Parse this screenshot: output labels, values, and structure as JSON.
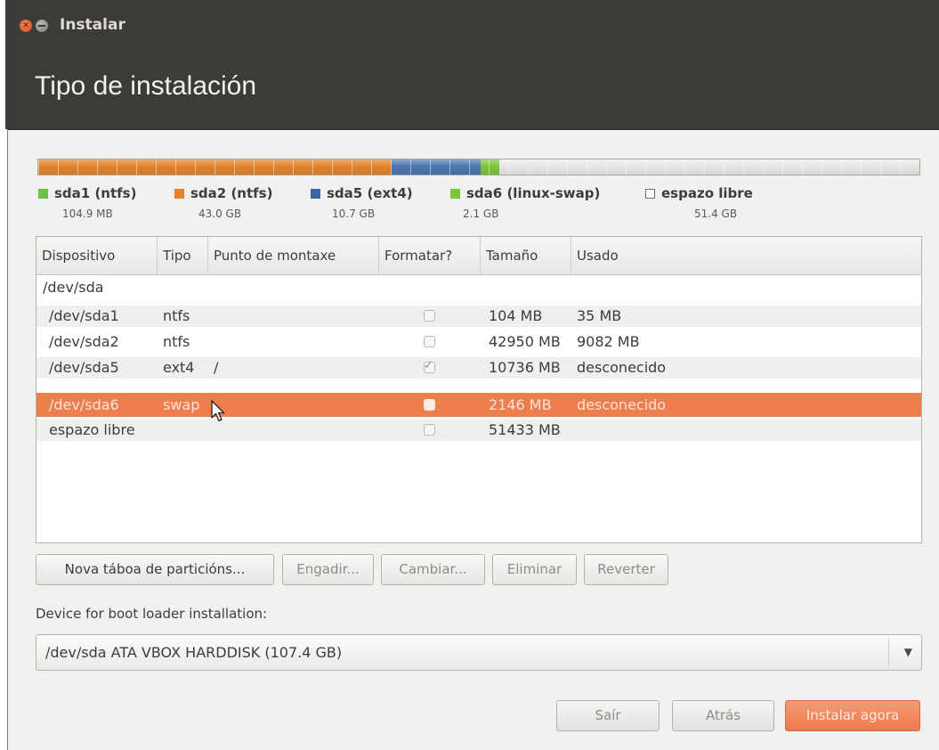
{
  "window": {
    "title": "Instalar"
  },
  "heading": "Tipo de instalación",
  "partition_bar": {
    "segments": [
      {
        "color": "#e2832e",
        "fraction": 0.4
      },
      {
        "color": "#4d76ad",
        "fraction": 0.1
      },
      {
        "color": "#7dc43a",
        "fraction": 0.02
      },
      {
        "color": "#e9e8e6",
        "fraction": 0.48
      }
    ]
  },
  "legend": [
    {
      "name": "sda1 (ntfs)",
      "size": "104.9 MB",
      "color": "#6cc14a"
    },
    {
      "name": "sda2 (ntfs)",
      "size": "43.0 GB",
      "color": "#e2832e"
    },
    {
      "name": "sda5 (ext4)",
      "size": "10.7 GB",
      "color": "#3b66a7"
    },
    {
      "name": "sda6 (linux-swap)",
      "size": "2.1 GB",
      "color": "#7dc43a"
    },
    {
      "name": "espazo libre",
      "size": "51.4 GB",
      "color": "#ffffff"
    }
  ],
  "table": {
    "headers": [
      "Dispositivo",
      "Tipo",
      "Punto de montaxe",
      "Formatar?",
      "Tamaño",
      "Usado"
    ],
    "rows": [
      {
        "device": "/dev/sda"
      },
      {
        "device": "/dev/sda1",
        "type": "ntfs",
        "mount": "",
        "format": false,
        "size": "104 MB",
        "used": "35 MB"
      },
      {
        "device": "/dev/sda2",
        "type": "ntfs",
        "mount": "",
        "format": false,
        "size": "42950 MB",
        "used": "9082 MB"
      },
      {
        "device": "/dev/sda5",
        "type": "ext4",
        "mount": "/",
        "format": true,
        "size": "10736 MB",
        "used": "desconecido"
      },
      {
        "device": "/dev/sda6",
        "type": "swap",
        "mount": "",
        "format": false,
        "size": "2146 MB",
        "used": "desconecido"
      },
      {
        "device": "espazo libre",
        "type": "",
        "mount": "",
        "format": false,
        "size": "51433 MB",
        "used": ""
      }
    ]
  },
  "buttons": {
    "new_table": "Nova táboa de particións...",
    "add": "Engadir...",
    "change": "Cambiar...",
    "delete": "Eliminar",
    "revert": "Reverter"
  },
  "bootloader": {
    "label": "Device for boot loader installation:",
    "value": "/dev/sda   ATA VBOX HARDDISK (107.4 GB)"
  },
  "actions": {
    "quit": "Saír",
    "back": "Atrás",
    "install": "Instalar agora"
  }
}
